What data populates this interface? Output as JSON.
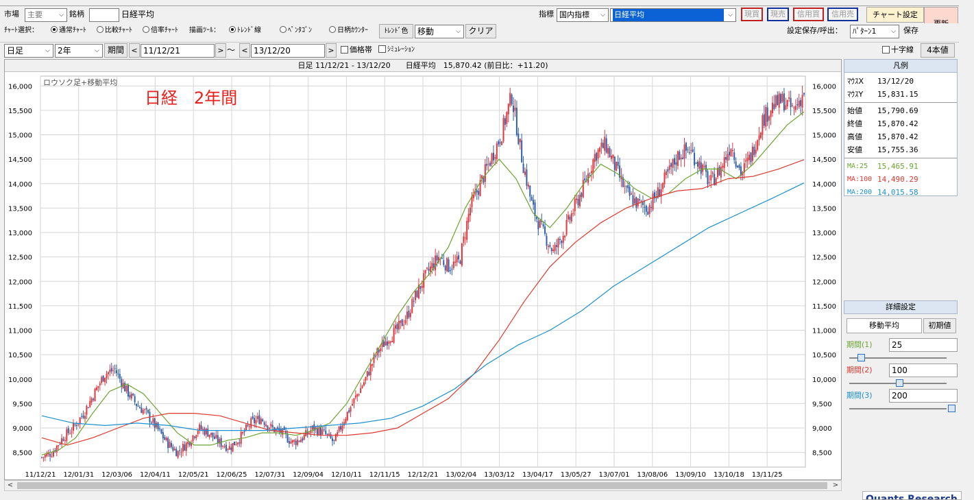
{
  "toolbar1": {
    "market_label": "市場",
    "market_value": "主要",
    "symbol_label": "銘柄",
    "symbol_value": "",
    "symbol_name": "日経平均",
    "indicator_label": "指標",
    "indicator_category": "国内指標",
    "indicator_value": "日経平均",
    "btn_spot_buy": "現買",
    "btn_spot_sell": "現売",
    "btn_margin_buy": "信用買",
    "btn_margin_sell": "信用売",
    "btn_chart_settings": "チャート設定",
    "btn_refresh": "更新"
  },
  "toolbar2": {
    "chart_select_label": "ﾁｬｰﾄ選択：",
    "chart_normal": "通常ﾁｬｰﾄ",
    "chart_compare": "比較ﾁｬｰﾄ",
    "chart_ratio": "倍率ﾁｬｰﾄ",
    "draw_tool_label": "描画ﾂｰﾙ：",
    "tool_trend": "ﾄﾚﾝﾄﾞ線",
    "tool_pentagon": "ﾍﾟﾝﾀｺﾞﾝ",
    "tool_counter": "日柄ｶｳﾝﾀｰ",
    "btn_trend_color": "ﾄﾚﾝﾄﾞ色",
    "move_value": "移動",
    "btn_clear": "クリア",
    "save_label": "設定保存/呼出：",
    "pattern_value": "ﾊﾟﾀｰﾝ1",
    "btn_save": "保存"
  },
  "toolbar3": {
    "period_type": "日足",
    "span": "2年",
    "btn_period": "期間",
    "date_from": "11/12/21",
    "tilde": "～",
    "date_to": "13/12/20",
    "price_band": "価格帯",
    "simulation": "ｼﾐｭﾚｰｼｮﾝ",
    "crosshair": "十字線",
    "btn_four_values": "4本値"
  },
  "chart_header": "日足 11/12/21 - 13/12/20　　日経平均　15,870.42 (前日比：+11.20)",
  "chart_data": {
    "type": "candlestick",
    "subtitle": "ロウソク足+移動平均",
    "annotation": "日経　2年間",
    "annotation_color": "#e8211d",
    "ylim": [
      8200,
      16200
    ],
    "yticks": [
      8500,
      9000,
      9500,
      10000,
      10500,
      11000,
      11500,
      12000,
      12500,
      13000,
      13500,
      14000,
      14500,
      15000,
      15500,
      16000
    ],
    "ytick_labels": [
      "8,500",
      "9,000",
      "9,500",
      "10,000",
      "10,500",
      "11,000",
      "11,500",
      "12,000",
      "12,500",
      "13,000",
      "13,500",
      "14,000",
      "14,500",
      "15,000",
      "15,500",
      "16,000"
    ],
    "xtick_labels": [
      "11/12/21",
      "12/01/31",
      "12/03/06",
      "12/04/11",
      "12/05/21",
      "12/06/25",
      "12/07/31",
      "12/09/04",
      "12/10/11",
      "12/11/15",
      "12/12/21",
      "13/02/04",
      "13/03/12",
      "13/04/17",
      "13/05/27",
      "13/07/01",
      "13/08/06",
      "13/09/10",
      "13/10/18",
      "13/11/25"
    ],
    "up_color": "#e0363c",
    "down_color": "#2f5fa8",
    "close_series": [
      8400,
      8500,
      8800,
      9000,
      9300,
      9700,
      10100,
      10200,
      9800,
      9500,
      9300,
      9000,
      8700,
      8500,
      8700,
      9000,
      8900,
      8700,
      8600,
      8800,
      9100,
      9200,
      9000,
      8900,
      8700,
      8800,
      9000,
      8900,
      8700,
      9200,
      9600,
      10000,
      10500,
      10800,
      11000,
      11300,
      11800,
      12200,
      12500,
      12300,
      12400,
      13500,
      14000,
      14500,
      15000,
      15800,
      14500,
      13500,
      13000,
      12600,
      13000,
      13500,
      14000,
      14600,
      14800,
      14300,
      13800,
      13600,
      13500,
      13800,
      14200,
      14600,
      14700,
      14400,
      14000,
      14300,
      14800,
      14200,
      14600,
      15300,
      15600,
      15700,
      15500,
      15870
    ],
    "series": [
      {
        "name": "MA:25",
        "color": "#6aa531",
        "values": [
          8450,
          8550,
          8800,
          9300,
          9750,
          9900,
          9700,
          9300,
          8900,
          8650,
          8650,
          8750,
          8800,
          8900,
          8900,
          8850,
          8950,
          9100,
          9500,
          10100,
          10700,
          11300,
          11800,
          12200,
          12700,
          13500,
          14100,
          14500,
          14100,
          13400,
          13100,
          13500,
          14000,
          14400,
          14200,
          13900,
          13700,
          13800,
          14100,
          14300,
          14300,
          14100,
          14400,
          14800,
          15200,
          15470
        ]
      },
      {
        "name": "MA:100",
        "color": "#e0382c",
        "values": [
          8800,
          8650,
          8800,
          9000,
          9200,
          9300,
          9300,
          9250,
          9100,
          8950,
          8900,
          8850,
          8850,
          8900,
          9000,
          9300,
          9600,
          10100,
          10800,
          11600,
          12300,
          12800,
          13200,
          13500,
          13700,
          13850,
          13900,
          14100,
          14150,
          14300,
          14490
        ]
      },
      {
        "name": "MA:200",
        "color": "#1a8fd0",
        "values": [
          9250,
          9100,
          9050,
          9100,
          9050,
          8950,
          8950,
          8950,
          9000,
          9050,
          9100,
          9200,
          9450,
          9800,
          10300,
          10700,
          11000,
          11400,
          11900,
          12300,
          12700,
          13100,
          13400,
          13700,
          14015
        ]
      }
    ]
  },
  "legend": {
    "title": "凡例",
    "rows": [
      {
        "k": "ﾏｳｽX",
        "v": "13/12/20"
      },
      {
        "k": "ﾏｳｽY",
        "v": "15,831.15"
      },
      {
        "k": "始値",
        "v": "15,790.69"
      },
      {
        "k": "終値",
        "v": "15,870.42"
      },
      {
        "k": "高値",
        "v": "15,870.42"
      },
      {
        "k": "安値",
        "v": "15,755.36"
      }
    ],
    "ma_rows": [
      {
        "k": "MA:25",
        "v": "15,465.91",
        "color": "#6aa531"
      },
      {
        "k": "MA:100",
        "v": "14,490.29",
        "color": "#e0382c"
      },
      {
        "k": "MA:200",
        "v": "14,015.58",
        "color": "#1a8fd0"
      }
    ]
  },
  "detail": {
    "title": "詳細設定",
    "tab_ma": "移動平均",
    "btn_initial": "初期値",
    "p1_label": "期間(1)",
    "p1_value": "25",
    "p1_color": "#6aa531",
    "p2_label": "期間(2)",
    "p2_value": "100",
    "p2_color": "#e0382c",
    "p3_label": "期間(3)",
    "p3_value": "200",
    "p3_color": "#1a8fd0"
  },
  "footer_logo": "Quants Research"
}
